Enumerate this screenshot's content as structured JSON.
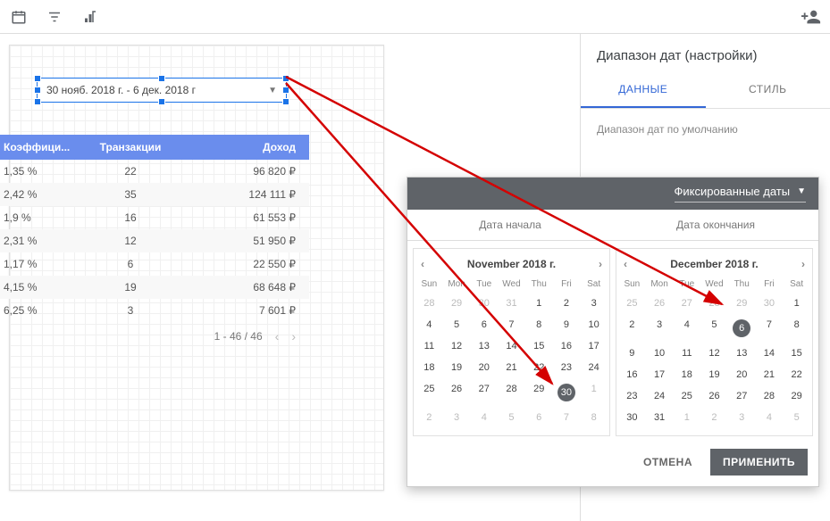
{
  "selected_control": {
    "label": "30 нояб. 2018 г. - 6 дек. 2018 г"
  },
  "table": {
    "headers": [
      "Коэффици...",
      "Транзакции",
      "Доход"
    ],
    "rows": [
      [
        "1,35 %",
        "22",
        "96 820 ₽"
      ],
      [
        "2,42 %",
        "35",
        "124 111 ₽"
      ],
      [
        "1,9 %",
        "16",
        "61 553 ₽"
      ],
      [
        "2,31 %",
        "12",
        "51 950 ₽"
      ],
      [
        "1,17 %",
        "6",
        "22 550 ₽"
      ],
      [
        "4,15 %",
        "19",
        "68 648 ₽"
      ],
      [
        "6,25 %",
        "3",
        "7 601 ₽"
      ]
    ],
    "pager": "1 - 46 / 46"
  },
  "side": {
    "title": "Диапазон дат (настройки)",
    "tab_data": "ДАННЫЕ",
    "tab_style": "СТИЛЬ",
    "section": "Диапазон дат по умолчанию"
  },
  "date_popup": {
    "dropdown": "Фиксированные даты",
    "start_label": "Дата начала",
    "end_label": "Дата окончания",
    "cal1": {
      "title": "November 2018 г.",
      "dow": [
        "Sun",
        "Mon",
        "Tue",
        "Wed",
        "Thu",
        "Fri",
        "Sat"
      ],
      "weeks": [
        [
          {
            "n": 28,
            "dim": true
          },
          {
            "n": 29,
            "dim": true
          },
          {
            "n": 30,
            "dim": true
          },
          {
            "n": 31,
            "dim": true
          },
          {
            "n": 1
          },
          {
            "n": 2
          },
          {
            "n": 3
          }
        ],
        [
          {
            "n": 4
          },
          {
            "n": 5
          },
          {
            "n": 6
          },
          {
            "n": 7
          },
          {
            "n": 8
          },
          {
            "n": 9
          },
          {
            "n": 10
          }
        ],
        [
          {
            "n": 11
          },
          {
            "n": 12
          },
          {
            "n": 13
          },
          {
            "n": 14
          },
          {
            "n": 15
          },
          {
            "n": 16
          },
          {
            "n": 17
          }
        ],
        [
          {
            "n": 18
          },
          {
            "n": 19
          },
          {
            "n": 20
          },
          {
            "n": 21
          },
          {
            "n": 22
          },
          {
            "n": 23
          },
          {
            "n": 24
          }
        ],
        [
          {
            "n": 25
          },
          {
            "n": 26
          },
          {
            "n": 27
          },
          {
            "n": 28
          },
          {
            "n": 29
          },
          {
            "n": 30,
            "sel": true
          },
          {
            "n": 1,
            "dim": true
          }
        ],
        [
          {
            "n": 2,
            "dim": true
          },
          {
            "n": 3,
            "dim": true
          },
          {
            "n": 4,
            "dim": true
          },
          {
            "n": 5,
            "dim": true
          },
          {
            "n": 6,
            "dim": true
          },
          {
            "n": 7,
            "dim": true
          },
          {
            "n": 8,
            "dim": true
          }
        ]
      ]
    },
    "cal2": {
      "title": "December 2018 г.",
      "dow": [
        "Sun",
        "Mon",
        "Tue",
        "Wed",
        "Thu",
        "Fri",
        "Sat"
      ],
      "weeks": [
        [
          {
            "n": 25,
            "dim": true
          },
          {
            "n": 26,
            "dim": true
          },
          {
            "n": 27,
            "dim": true
          },
          {
            "n": 28,
            "dim": true
          },
          {
            "n": 29,
            "dim": true
          },
          {
            "n": 30,
            "dim": true
          },
          {
            "n": 1
          }
        ],
        [
          {
            "n": 2
          },
          {
            "n": 3
          },
          {
            "n": 4
          },
          {
            "n": 5
          },
          {
            "n": 6,
            "sel": true
          },
          {
            "n": 7
          },
          {
            "n": 8
          }
        ],
        [
          {
            "n": 9
          },
          {
            "n": 10
          },
          {
            "n": 11
          },
          {
            "n": 12
          },
          {
            "n": 13
          },
          {
            "n": 14
          },
          {
            "n": 15
          }
        ],
        [
          {
            "n": 16
          },
          {
            "n": 17
          },
          {
            "n": 18
          },
          {
            "n": 19
          },
          {
            "n": 20
          },
          {
            "n": 21
          },
          {
            "n": 22
          }
        ],
        [
          {
            "n": 23
          },
          {
            "n": 24
          },
          {
            "n": 25
          },
          {
            "n": 26
          },
          {
            "n": 27
          },
          {
            "n": 28
          },
          {
            "n": 29
          }
        ],
        [
          {
            "n": 30
          },
          {
            "n": 31
          },
          {
            "n": 1,
            "dim": true
          },
          {
            "n": 2,
            "dim": true
          },
          {
            "n": 3,
            "dim": true
          },
          {
            "n": 4,
            "dim": true
          },
          {
            "n": 5,
            "dim": true
          }
        ]
      ]
    },
    "cancel": "ОТМЕНА",
    "apply": "ПРИМЕНИТЬ"
  }
}
